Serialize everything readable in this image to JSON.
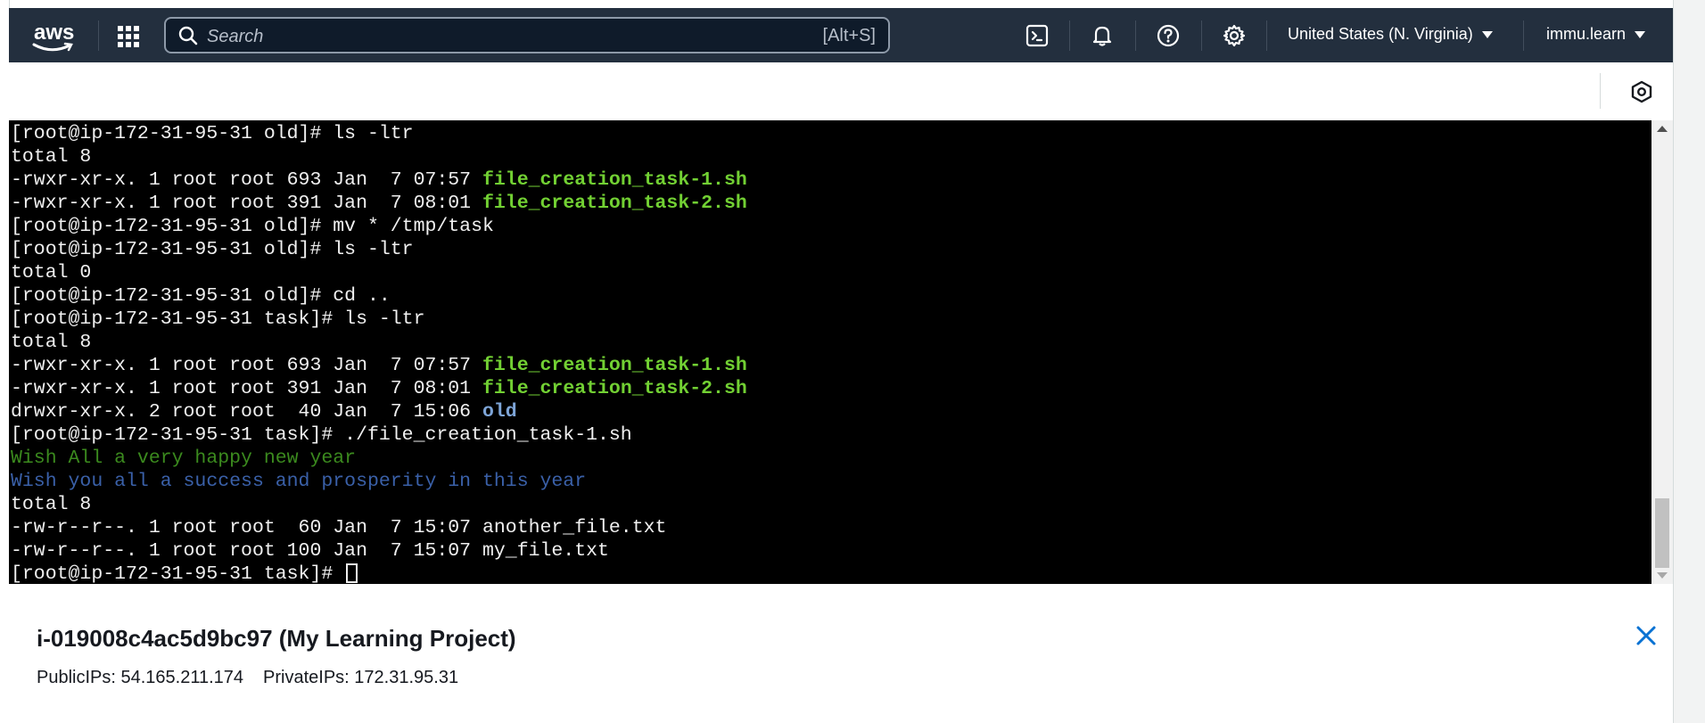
{
  "header": {
    "logo_text": "aws",
    "search_placeholder": "Search",
    "search_shortcut": "[Alt+S]",
    "region": "United States (N. Virginia)",
    "user": "immu.learn",
    "icons": [
      "services-grid-icon",
      "cloudshell-icon",
      "bell-icon",
      "help-icon",
      "gear-icon"
    ]
  },
  "terminal": {
    "lines": [
      {
        "parts": [
          {
            "t": "[root@ip-172-31-95-31 old]# ls -ltr",
            "c": ""
          }
        ]
      },
      {
        "parts": [
          {
            "t": "total 8",
            "c": ""
          }
        ]
      },
      {
        "parts": [
          {
            "t": "-rwxr-xr-x. 1 root root 693 Jan  7 07:57 ",
            "c": ""
          },
          {
            "t": "file_creation_task-1.sh",
            "c": "exec"
          }
        ]
      },
      {
        "parts": [
          {
            "t": "-rwxr-xr-x. 1 root root 391 Jan  7 08:01 ",
            "c": ""
          },
          {
            "t": "file_creation_task-2.sh",
            "c": "exec"
          }
        ]
      },
      {
        "parts": [
          {
            "t": "[root@ip-172-31-95-31 old]# mv * /tmp/task",
            "c": ""
          }
        ]
      },
      {
        "parts": [
          {
            "t": "[root@ip-172-31-95-31 old]# ls -ltr",
            "c": ""
          }
        ]
      },
      {
        "parts": [
          {
            "t": "total 0",
            "c": ""
          }
        ]
      },
      {
        "parts": [
          {
            "t": "[root@ip-172-31-95-31 old]# cd ..",
            "c": ""
          }
        ]
      },
      {
        "parts": [
          {
            "t": "[root@ip-172-31-95-31 task]# ls -ltr",
            "c": ""
          }
        ]
      },
      {
        "parts": [
          {
            "t": "total 8",
            "c": ""
          }
        ]
      },
      {
        "parts": [
          {
            "t": "-rwxr-xr-x. 1 root root 693 Jan  7 07:57 ",
            "c": ""
          },
          {
            "t": "file_creation_task-1.sh",
            "c": "exec"
          }
        ]
      },
      {
        "parts": [
          {
            "t": "-rwxr-xr-x. 1 root root 391 Jan  7 08:01 ",
            "c": ""
          },
          {
            "t": "file_creation_task-2.sh",
            "c": "exec"
          }
        ]
      },
      {
        "parts": [
          {
            "t": "drwxr-xr-x. 2 root root  40 Jan  7 15:06 ",
            "c": ""
          },
          {
            "t": "old",
            "c": "dir"
          }
        ]
      },
      {
        "parts": [
          {
            "t": "[root@ip-172-31-95-31 task]# ./file_creation_task-1.sh",
            "c": ""
          }
        ]
      },
      {
        "parts": [
          {
            "t": "Wish All a very happy new year",
            "c": "green-out"
          }
        ]
      },
      {
        "parts": [
          {
            "t": "Wish you all a success and prosperity in this year",
            "c": "blue-out"
          }
        ]
      },
      {
        "parts": [
          {
            "t": "total 8",
            "c": ""
          }
        ]
      },
      {
        "parts": [
          {
            "t": "-rw-r--r--. 1 root root  60 Jan  7 15:07 another_file.txt",
            "c": ""
          }
        ]
      },
      {
        "parts": [
          {
            "t": "-rw-r--r--. 1 root root 100 Jan  7 15:07 my_file.txt",
            "c": ""
          }
        ]
      },
      {
        "parts": [
          {
            "t": "[root@ip-172-31-95-31 task]# ",
            "c": ""
          }
        ],
        "cursor": true
      }
    ],
    "colors": {
      "executable": "#72d033",
      "directory": "#7ea5d8",
      "green_output": "#3b8a1e",
      "blue_output": "#3a60a8"
    }
  },
  "instance": {
    "title": "i-019008c4ac5d9bc97 (My Learning Project)",
    "public_ips": "PublicIPs: 54.165.211.174",
    "private_ips": "PrivateIPs: 172.31.95.31"
  }
}
